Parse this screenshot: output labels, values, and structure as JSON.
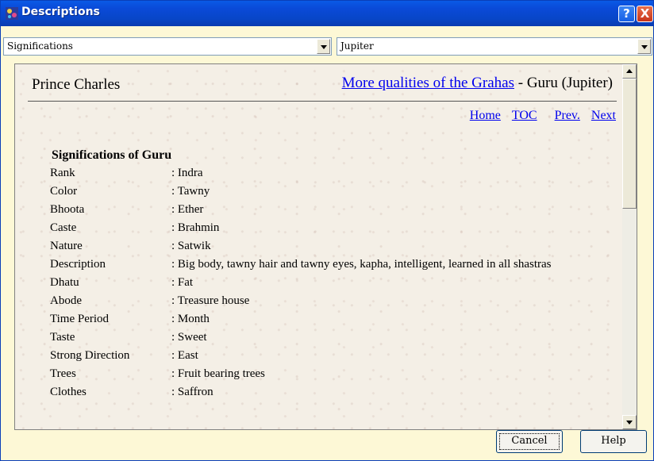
{
  "window": {
    "title": "Descriptions",
    "help_glyph": "?",
    "close_glyph": "X"
  },
  "combos": {
    "left_value": "Significations",
    "right_value": "Jupiter"
  },
  "page": {
    "person": "Prince Charles",
    "heading_link": "More qualities of the Grahas",
    "heading_rest": " - Guru (Jupiter)",
    "nav": {
      "home": "Home",
      "toc": "TOC",
      "prev": "Prev.",
      "next": "Next"
    },
    "section_title": "Significations of Guru",
    "rows": [
      {
        "key": "Rank",
        "value": ": Indra"
      },
      {
        "key": "Color",
        "value": ": Tawny"
      },
      {
        "key": "Bhoota",
        "value": ": Ether"
      },
      {
        "key": "Caste",
        "value": ": Brahmin"
      },
      {
        "key": "Nature",
        "value": ": Satwik"
      },
      {
        "key": "Description",
        "value": ": Big body, tawny hair and tawny eyes, kapha, intelligent, learned in all shastras"
      },
      {
        "key": "Dhatu",
        "value": ": Fat"
      },
      {
        "key": "Abode",
        "value": ": Treasure house"
      },
      {
        "key": "Time Period",
        "value": ": Month"
      },
      {
        "key": "Taste",
        "value": ": Sweet"
      },
      {
        "key": "Strong Direction",
        "value": ": East"
      },
      {
        "key": "Trees",
        "value": ": Fruit bearing trees"
      },
      {
        "key": "Clothes",
        "value": ": Saffron"
      }
    ]
  },
  "buttons": {
    "cancel": "Cancel",
    "help": "Help"
  },
  "icons": {
    "app": "app-icon",
    "dropdown": "chevron-down-icon"
  }
}
